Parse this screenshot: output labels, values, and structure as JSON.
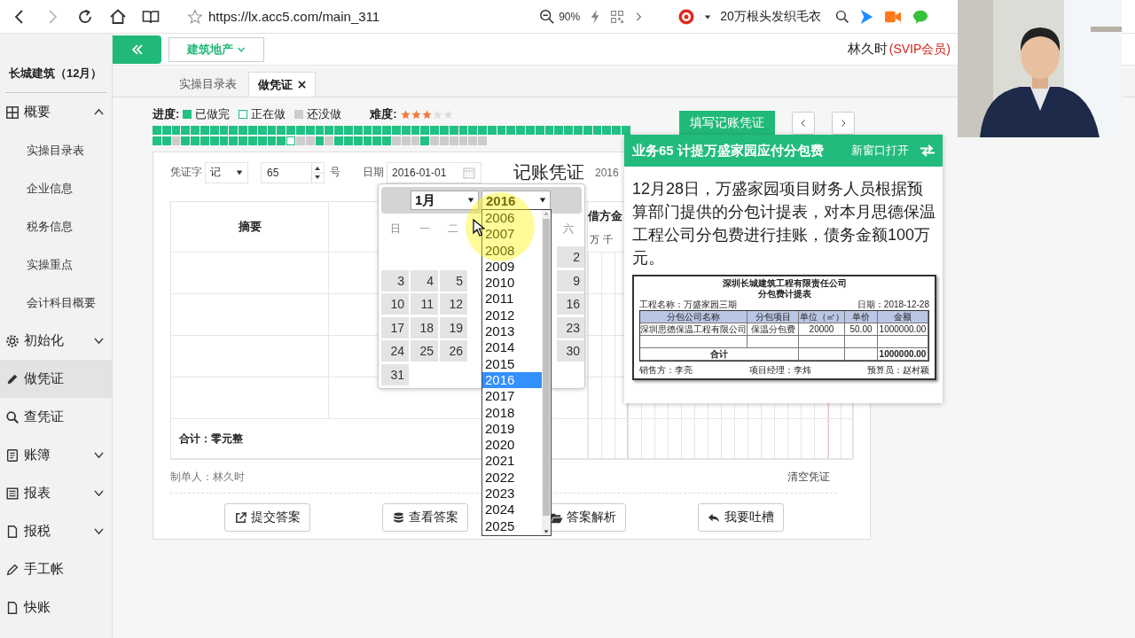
{
  "browser": {
    "can_go_forward": false,
    "url": "https://lx.acc5.com/main_311",
    "zoom": "90%",
    "suggestion": "20万根头发织毛衣"
  },
  "sidebar": {
    "title": "长城建筑（12月）",
    "items": [
      {
        "label": "概要",
        "kind": "group",
        "expanded": true,
        "selected": false,
        "children": [
          {
            "label": "实操目录表",
            "selected": false
          },
          {
            "label": "企业信息",
            "selected": false
          },
          {
            "label": "税务信息",
            "selected": false
          },
          {
            "label": "实操重点",
            "selected": false
          },
          {
            "label": "会计科目概要",
            "selected": false
          }
        ]
      },
      {
        "label": "初始化",
        "kind": "group",
        "expanded": false,
        "selected": false
      },
      {
        "label": "做凭证",
        "kind": "link",
        "selected": true
      },
      {
        "label": "查凭证",
        "kind": "link",
        "selected": false
      },
      {
        "label": "账簿",
        "kind": "group",
        "expanded": false,
        "selected": false
      },
      {
        "label": "报表",
        "kind": "group",
        "expanded": false,
        "selected": false
      },
      {
        "label": "报税",
        "kind": "group",
        "expanded": false,
        "selected": false
      },
      {
        "label": "手工帐",
        "kind": "link",
        "selected": false
      },
      {
        "label": "快账",
        "kind": "link",
        "selected": false
      }
    ]
  },
  "header": {
    "industry": "建筑地产",
    "user": "林久时",
    "membership": "(SVIP会员)"
  },
  "tabs": [
    {
      "label": "实操目录表",
      "selected": false,
      "closable": false
    },
    {
      "label": "做凭证",
      "selected": true,
      "closable": true
    }
  ],
  "progress": {
    "label": "进度:",
    "legend": [
      {
        "label": "已做完",
        "kind": "done"
      },
      {
        "label": "正在做",
        "kind": "current"
      },
      {
        "label": "还没做",
        "kind": "todo"
      }
    ],
    "difficulty": {
      "label": "难度:",
      "stars": 3
    },
    "rows": [
      [
        {
          "kind": "done"
        },
        {
          "kind": "done"
        },
        {
          "kind": "done"
        },
        {
          "kind": "done"
        },
        {
          "kind": "done"
        },
        {
          "kind": "done"
        },
        {
          "kind": "done"
        },
        {
          "kind": "done"
        },
        {
          "kind": "done"
        },
        {
          "kind": "done"
        },
        {
          "kind": "done"
        },
        {
          "kind": "done"
        },
        {
          "kind": "done"
        },
        {
          "kind": "done"
        },
        {
          "kind": "done"
        },
        {
          "kind": "done"
        },
        {
          "kind": "done"
        },
        {
          "kind": "done"
        },
        {
          "kind": "done"
        },
        {
          "kind": "done"
        },
        {
          "kind": "done"
        },
        {
          "kind": "done"
        },
        {
          "kind": "done"
        },
        {
          "kind": "done"
        },
        {
          "kind": "done"
        },
        {
          "kind": "done"
        },
        {
          "kind": "done"
        },
        {
          "kind": "done"
        },
        {
          "kind": "done"
        },
        {
          "kind": "done"
        },
        {
          "kind": "done"
        },
        {
          "kind": "done"
        },
        {
          "kind": "done"
        },
        {
          "kind": "done"
        },
        {
          "kind": "done"
        },
        {
          "kind": "done"
        },
        {
          "kind": "done"
        },
        {
          "kind": "done"
        },
        {
          "kind": "done"
        },
        {
          "kind": "done"
        },
        {
          "kind": "done"
        },
        {
          "kind": "done"
        },
        {
          "kind": "done"
        },
        {
          "kind": "done"
        },
        {
          "kind": "done"
        },
        {
          "kind": "done"
        },
        {
          "kind": "done"
        },
        {
          "kind": "done"
        },
        {
          "kind": "done"
        },
        {
          "kind": "done"
        }
      ],
      [
        {
          "kind": "done"
        },
        {
          "kind": "done"
        },
        {
          "kind": "todo"
        },
        {
          "kind": "done"
        },
        {
          "kind": "done"
        },
        {
          "kind": "done"
        },
        {
          "kind": "done"
        },
        {
          "kind": "done"
        },
        {
          "kind": "done"
        },
        {
          "kind": "done"
        },
        {
          "kind": "done"
        },
        {
          "kind": "done"
        },
        {
          "kind": "done"
        },
        {
          "kind": "done"
        },
        {
          "kind": "current"
        },
        {
          "kind": "todo"
        },
        {
          "kind": "todo"
        },
        {
          "kind": "done"
        },
        {
          "kind": "todo"
        },
        {
          "kind": "done"
        },
        {
          "kind": "done"
        },
        {
          "kind": "done"
        },
        {
          "kind": "done"
        },
        {
          "kind": "done"
        },
        {
          "kind": "done"
        },
        {
          "kind": "todo"
        },
        {
          "kind": "todo"
        },
        {
          "kind": "todo"
        },
        {
          "kind": "done"
        },
        {
          "kind": "todo"
        },
        {
          "kind": "todo"
        },
        {
          "kind": "todo"
        },
        {
          "kind": "todo"
        },
        {
          "kind": "todo"
        },
        {
          "kind": "todo"
        }
      ]
    ]
  },
  "actions": {
    "fill": "填写记账凭证"
  },
  "voucher": {
    "word_label": "凭证字",
    "word": "记",
    "number": "65",
    "number_suffix": "号",
    "date_label": "日期",
    "date": "2016-01-01",
    "title": "记账凭证",
    "date_caption": "2016",
    "summary_header": "摘要",
    "debit_header": "借方金",
    "digit_labels": [
      "万",
      "千"
    ],
    "total": "合计：零元整",
    "preparer": "制单人：林久时",
    "clear": "清空凭证",
    "buttons": [
      {
        "label": "提交答案",
        "kind": "submit"
      },
      {
        "label": "查看答案",
        "kind": "view"
      },
      {
        "label": "答案解析",
        "kind": "analysis"
      },
      {
        "label": "我要吐槽",
        "kind": "feedback"
      }
    ]
  },
  "calendar": {
    "month": "1月",
    "year": "2016",
    "weekdays": {
      "sun": "日",
      "mon": "一",
      "tue": "二",
      "sat": "六"
    },
    "weeks": [
      {
        "sat": "2"
      },
      {
        "sun": "3",
        "mon": "4",
        "tue": "5",
        "sat": "9"
      },
      {
        "sun": "10",
        "mon": "11",
        "tue": "12",
        "sat": "16"
      },
      {
        "sun": "17",
        "mon": "18",
        "tue": "19",
        "sat": "23"
      },
      {
        "sun": "24",
        "mon": "25",
        "tue": "26",
        "sat": "30"
      },
      {
        "sun": "31"
      }
    ]
  },
  "year_list": [
    {
      "label": "2006",
      "selected": false
    },
    {
      "label": "2007",
      "selected": false
    },
    {
      "label": "2008",
      "selected": false
    },
    {
      "label": "2009",
      "selected": false
    },
    {
      "label": "2010",
      "selected": false
    },
    {
      "label": "2011",
      "selected": false
    },
    {
      "label": "2012",
      "selected": false
    },
    {
      "label": "2013",
      "selected": false
    },
    {
      "label": "2014",
      "selected": false
    },
    {
      "label": "2015",
      "selected": false
    },
    {
      "label": "2016",
      "selected": true
    },
    {
      "label": "2017",
      "selected": false
    },
    {
      "label": "2018",
      "selected": false
    },
    {
      "label": "2019",
      "selected": false
    },
    {
      "label": "2020",
      "selected": false
    },
    {
      "label": "2021",
      "selected": false
    },
    {
      "label": "2022",
      "selected": false
    },
    {
      "label": "2023",
      "selected": false
    },
    {
      "label": "2024",
      "selected": false
    },
    {
      "label": "2025",
      "selected": false
    }
  ],
  "task": {
    "title": "业务65 计提万盛家园应付分包费",
    "open_new": "新窗口打开",
    "description": "12月28日，万盛家园项目财务人员根据预算部门提供的分包计提表，对本月思德保温工程公司分包费进行挂账，债务金额100万元。",
    "document": {
      "company": "深圳长城建筑工程有限责任公司",
      "title": "分包费计提表",
      "project": "工程名称：万盛家园三期",
      "date": "日期：2018-12-28",
      "columns": [
        "分包公司名称",
        "分包项目",
        "单位（㎡）",
        "单价",
        "金额"
      ],
      "rows": [
        [
          "深圳思德保温工程有限公司",
          "保温分包费",
          "20000",
          "50.00",
          "1000000.00"
        ]
      ],
      "total_label": "合计",
      "total": "1000000.00",
      "signatures": [
        "销售方：李亮",
        "项目经理：李炜",
        "预算员：赵村颖"
      ]
    }
  }
}
